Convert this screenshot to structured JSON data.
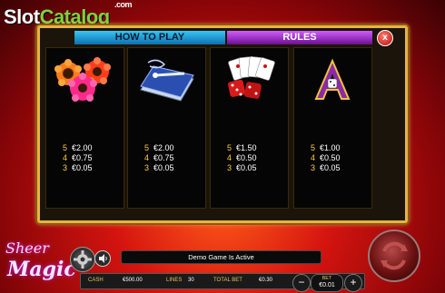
{
  "watermark": {
    "part1": "Slot",
    "part2": "Catalog",
    "part3": ".com"
  },
  "paytable": {
    "tabs": {
      "how_to_play": "HOW TO PLAY",
      "rules": "RULES"
    },
    "close": "x",
    "symbols": [
      {
        "icon": "flowers-icon",
        "pays": [
          {
            "count": "5",
            "amount": "€2.00"
          },
          {
            "count": "4",
            "amount": "€0.75"
          },
          {
            "count": "3",
            "amount": "€0.05"
          }
        ]
      },
      {
        "icon": "magic-book-icon",
        "pays": [
          {
            "count": "5",
            "amount": "€2.00"
          },
          {
            "count": "4",
            "amount": "€0.75"
          },
          {
            "count": "3",
            "amount": "€0.05"
          }
        ]
      },
      {
        "icon": "cards-dice-icon",
        "pays": [
          {
            "count": "5",
            "amount": "€1.50"
          },
          {
            "count": "4",
            "amount": "€0.50"
          },
          {
            "count": "3",
            "amount": "€0.05"
          }
        ]
      },
      {
        "icon": "letter-a-icon",
        "pays": [
          {
            "count": "5",
            "amount": "€1.00"
          },
          {
            "count": "4",
            "amount": "€0.50"
          },
          {
            "count": "3",
            "amount": "€0.05"
          }
        ]
      }
    ]
  },
  "logo": {
    "line1": "Sheer",
    "line2": "Magic"
  },
  "status": "Demo Game Is Active",
  "bottom": {
    "cash_label": "CASH",
    "cash_value": "€500.00",
    "lines_label": "LINES",
    "lines_value": "30",
    "total_bet_label": "TOTAL BET",
    "total_bet_value": "€0.30",
    "bet_label": "BET",
    "bet_value": "€0.01",
    "minus": "−",
    "plus": "+"
  },
  "colors": {
    "accent_gold": "#e7b341",
    "tab_blue": "#37c6f5",
    "tab_purple": "#b43be0",
    "text_gold": "#ffcc33"
  }
}
